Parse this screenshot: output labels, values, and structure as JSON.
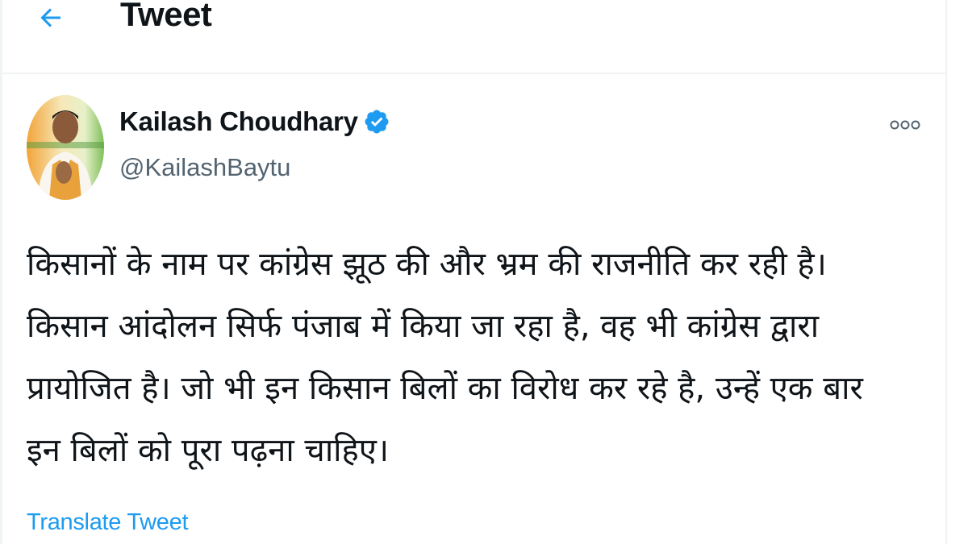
{
  "header": {
    "title": "Tweet",
    "back_icon": "arrow-left-icon",
    "accent_color": "#1d9bf0"
  },
  "tweet": {
    "author_name": "Kailash Choudhary",
    "author_handle": "@KailashBaytu",
    "verified": true,
    "verified_icon": "verified-badge-icon",
    "more_icon": "more-options-icon",
    "text": "किसानों के नाम पर कांग्रेस झूठ की और भ्रम की राजनीति कर रही है।\nकिसान आंदोलन सिर्फ पंजाब में किया जा रहा है, वह भी कांग्रेस द्वारा\nप्रायोजित है। जो भी इन किसान बिलों का विरोध कर रहे है, उन्हें एक बार\nइन बिलों को पूरा पढ़ना चाहिए।",
    "translate_label": "Translate Tweet"
  }
}
